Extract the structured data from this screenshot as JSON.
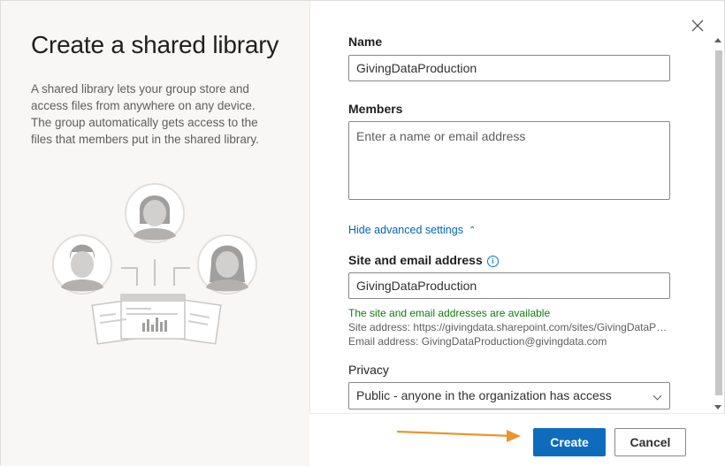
{
  "dialog": {
    "title": "Create a shared library",
    "description": "A shared library lets your group store and access files from anywhere on any device. The group automatically gets access to the files that members put in the shared library."
  },
  "form": {
    "name_label": "Name",
    "name_value": "GivingDataProduction",
    "members_label": "Members",
    "members_placeholder": "Enter a name or email address",
    "advanced_link": "Hide advanced settings",
    "site_label": "Site and email address",
    "site_value": "GivingDataProduction",
    "availability_message": "The site and email addresses are available",
    "site_address": "Site address: https://givingdata.sharepoint.com/sites/GivingDataProduction",
    "email_address": "Email address: GivingDataProduction@givingdata.com",
    "privacy_label": "Privacy",
    "privacy_value": "Public - anyone in the organization has access"
  },
  "footer": {
    "create_label": "Create",
    "cancel_label": "Cancel"
  },
  "colors": {
    "primary": "#0f6cbd",
    "link": "#0067b8",
    "success": "#107c10",
    "annotation_arrow": "#e8962e"
  },
  "icons": [
    "close-icon",
    "info-icon",
    "chevron-up-icon",
    "chevron-down-icon",
    "shared-library-illustration"
  ]
}
